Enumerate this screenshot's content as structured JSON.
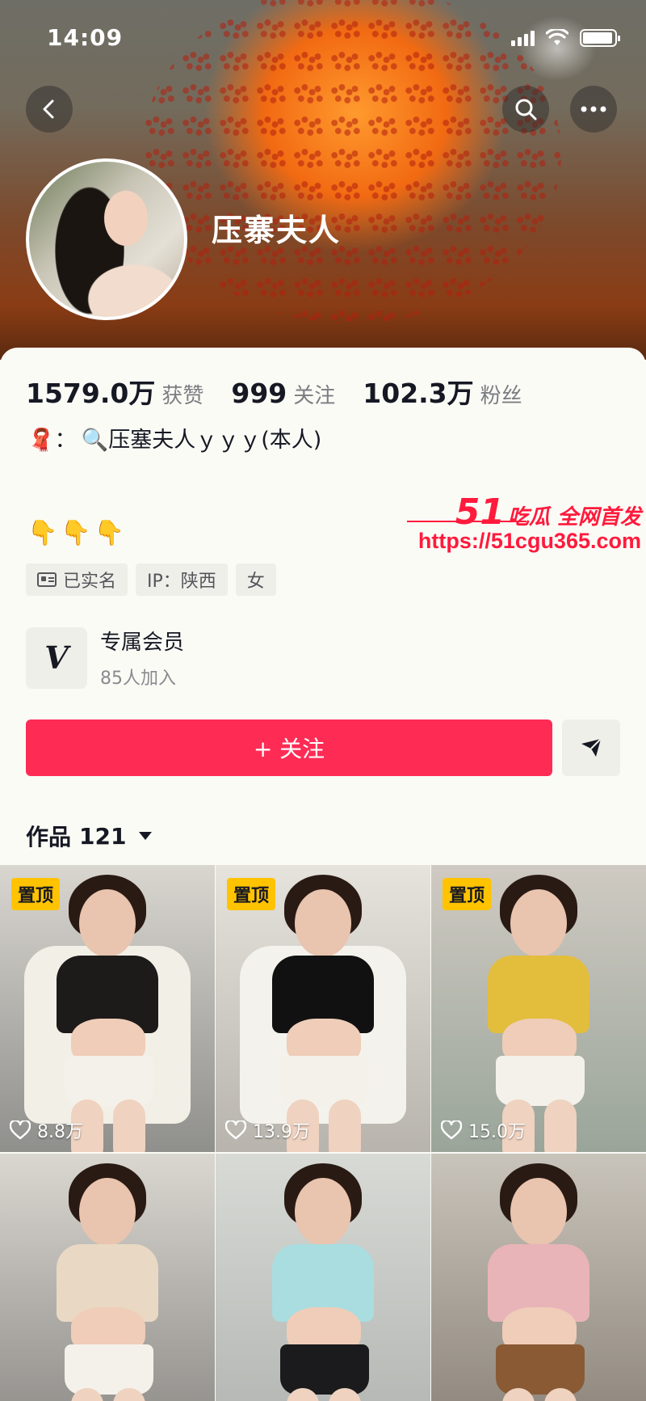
{
  "status": {
    "time": "14:09"
  },
  "profile": {
    "nickname": "压寨夫人",
    "stats": [
      {
        "num": "1579.0万",
        "label": "获赞"
      },
      {
        "num": "999",
        "label": "关注"
      },
      {
        "num": "102.3万",
        "label": "粉丝"
      }
    ],
    "bio_prefix": "🧣：",
    "bio_text": "🔍压塞夫人ｙｙｙ(本人)",
    "bio_emoji": "👇👇👇",
    "tags": [
      {
        "label": "已实名",
        "icon": "id-card-icon"
      },
      {
        "label": "IP：陕西"
      },
      {
        "label": "女"
      }
    ]
  },
  "member": {
    "title": "专属会员",
    "subtitle": "85人加入",
    "icon_glyph": "V"
  },
  "actions": {
    "follow_label": "+ 关注"
  },
  "works": {
    "label": "作品",
    "count": "121"
  },
  "watermark": {
    "num": "51",
    "text": "吃瓜 全网首发",
    "url": "https://51cgu365.com"
  },
  "videos": [
    {
      "pinned": "置顶",
      "likes": "8.8万",
      "top_color": "#1d1a1a",
      "skirt_color": "#f4f1ea",
      "bg": [
        "#d9d6d0",
        "#8f8f8c"
      ],
      "outer": "#f2efe6"
    },
    {
      "pinned": "置顶",
      "likes": "13.9万",
      "top_color": "#111",
      "skirt_color": "#f4f1ea",
      "bg": [
        "#e6e3dd",
        "#b8b4ad"
      ],
      "outer": "#f4f2ec"
    },
    {
      "pinned": "置顶",
      "likes": "15.0万",
      "top_color": "#e3bd3c",
      "skirt_color": "#f4f1ea",
      "bg": [
        "#cfcac2",
        "#9aa59a"
      ],
      "outer": ""
    },
    {
      "pinned": "",
      "likes": "",
      "top_color": "#e9d9c4",
      "skirt_color": "#f4f1ea",
      "bg": [
        "#dad7d1",
        "#8c8a86"
      ],
      "outer": ""
    },
    {
      "pinned": "",
      "likes": "",
      "top_color": "#a9dde0",
      "skirt_color": "#1b1b1d",
      "bg": [
        "#d8dad6",
        "#b1b4b0"
      ],
      "outer": ""
    },
    {
      "pinned": "",
      "likes": "",
      "top_color": "#e8b4b8",
      "skirt_color": "#8a5a34",
      "bg": [
        "#c9c4bb",
        "#8a8278"
      ],
      "outer": ""
    }
  ]
}
